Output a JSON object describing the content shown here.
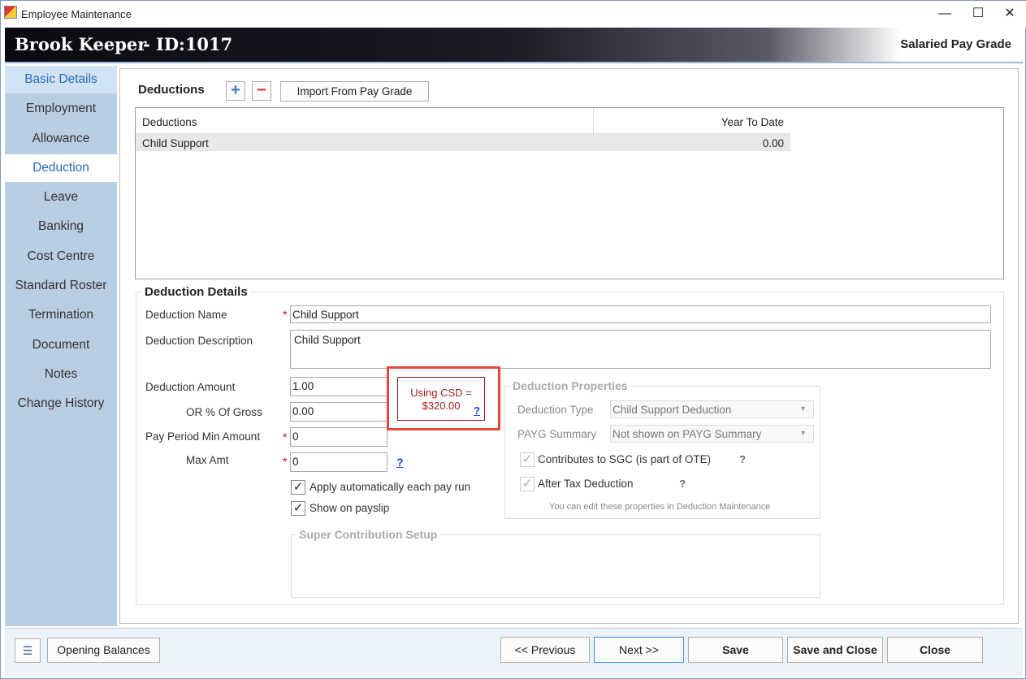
{
  "window": {
    "title": "Employee Maintenance",
    "minimize": "—",
    "maximize": "☐",
    "close": "✕"
  },
  "header": {
    "name": "Brook Keeper",
    "id": "- ID:1017",
    "pay_grade": "Salaried Pay Grade"
  },
  "sidebar": {
    "items": [
      {
        "label": "Basic Details"
      },
      {
        "label": "Employment"
      },
      {
        "label": "Allowance"
      },
      {
        "label": "Deduction"
      },
      {
        "label": "Leave"
      },
      {
        "label": "Banking"
      },
      {
        "label": "Cost Centre"
      },
      {
        "label": "Standard Roster"
      },
      {
        "label": "Termination"
      },
      {
        "label": "Document"
      },
      {
        "label": "Notes"
      },
      {
        "label": "Change History"
      }
    ]
  },
  "deductions": {
    "title": "Deductions",
    "add": "+",
    "remove": "−",
    "import_label": "Import From Pay Grade",
    "columns": [
      "Deductions",
      "Year To Date"
    ],
    "rows": [
      {
        "name": "Child Support",
        "ytd": "0.00"
      }
    ]
  },
  "details": {
    "title": "Deduction Details",
    "name_label": "Deduction Name",
    "name_value": "Child Support",
    "desc_label": "Deduction Description",
    "desc_value": "Child Support",
    "amount_label": "Deduction Amount",
    "amount_value": "1.00",
    "gross_label": "OR % Of Gross",
    "gross_value": "0.00",
    "min_label": "Pay Period Min Amount",
    "min_value": "0",
    "max_label": "Max Amt",
    "max_value": "0",
    "star": "*",
    "help": "?",
    "auto_label": "Apply automatically each pay run",
    "payslip_label": "Show on payslip",
    "check": "✓",
    "csd_line1": "Using CSD =",
    "csd_line2": "$320.00",
    "super_title": "Super Contribution Setup"
  },
  "properties": {
    "title": "Deduction Properties",
    "type_label": "Deduction Type",
    "type_value": "Child Support Deduction",
    "payg_label": "PAYG Summary",
    "payg_value": "Not shown on PAYG Summary",
    "sgc_label": "Contributes to SGC (is part of OTE)",
    "after_tax_label": "After Tax Deduction",
    "note": "You can edit these properties in Deduction Maintenance",
    "caret": "▼"
  },
  "footer": {
    "opening": "Opening Balances",
    "previous": "<< Previous",
    "next": "Next >>",
    "save": "Save",
    "save_close": "Save and Close",
    "close": "Close"
  }
}
